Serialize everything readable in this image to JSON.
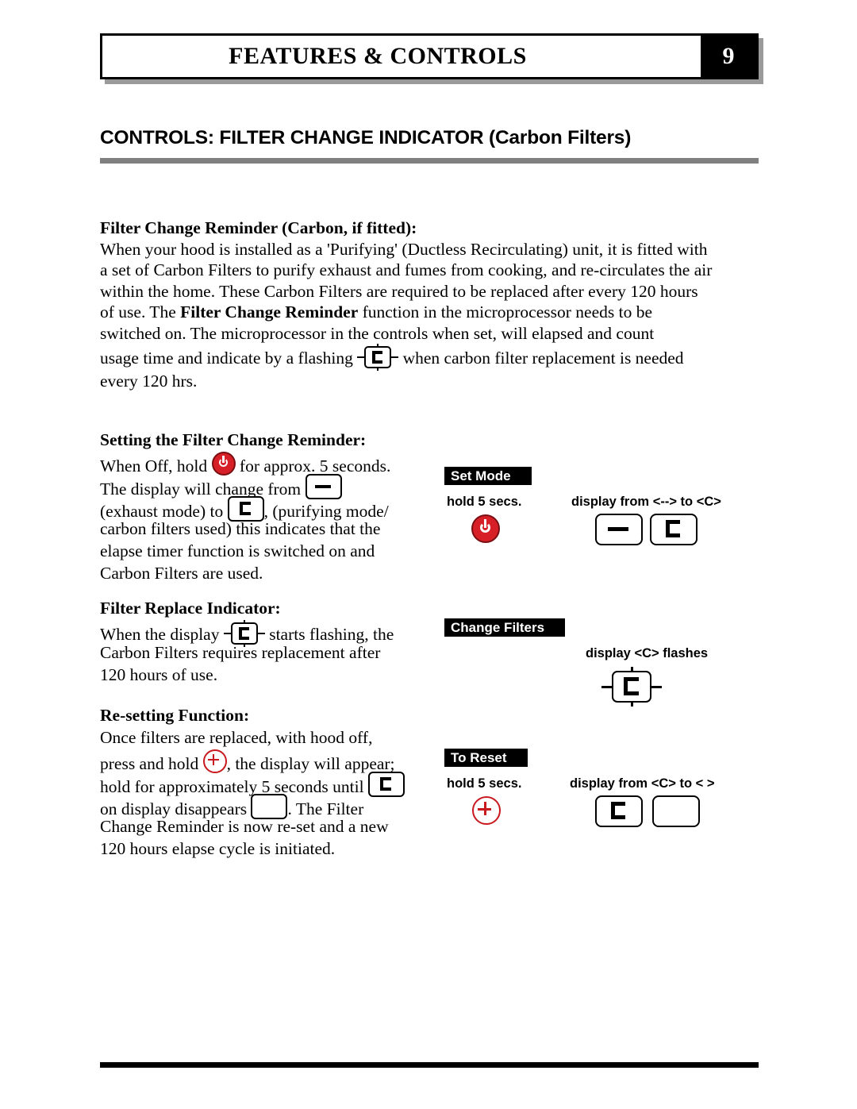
{
  "header": {
    "title": "FEATURES & CONTROLS",
    "page_number": "9"
  },
  "section": {
    "title": "CONTROLS: FILTER CHANGE INDICATOR (Carbon Filters)"
  },
  "intro": {
    "heading": "Filter Change Reminder (Carbon, if fitted):",
    "line1": "When your hood is installed as a 'Purifying' (Ductless Recirculating) unit, it is fitted with",
    "line2": "a set of Carbon Filters to purify exhaust and fumes from cooking, and re-circulates the air",
    "line3": "within the home.  These Carbon Filters are required to be replaced after every 120 hours",
    "line4a": "of use.  The ",
    "line4b": "Filter Change Reminder",
    "line4c": " function in the microprocessor needs to be",
    "line5": "switched on.  The microprocessor in the controls when set, will elapsed and count",
    "line6a": "usage time and indicate by a flashing",
    "line6b": "when carbon filter replacement is needed",
    "line7": "every 120 hrs."
  },
  "setting": {
    "heading": "Setting the Filter Change Reminder:",
    "l1a": "When Off, hold",
    "l1b": "for approx. 5 seconds.",
    "l2a": "The display will change from",
    "l3a": "(exhaust mode) to",
    "l3b": ", (purifying mode/",
    "l4": "carbon filters used) this indicates that the",
    "l5": "elapse timer function is switched on and",
    "l6": "Carbon Filters are used."
  },
  "replace": {
    "heading": "Filter Replace Indicator:",
    "l1a": "When the display",
    "l1b": "starts flashing, the",
    "l2": "Carbon Filters requires replacement after",
    "l3": "120 hours of use."
  },
  "reset": {
    "heading": "Re-setting Function:",
    "l1": "Once filters are replaced, with hood off,",
    "l2a": "press and hold",
    "l2b": ", the display will appear;",
    "l3a": "hold for approximately 5 seconds until",
    "l4a": "on display disappears",
    "l4b": ".  The Filter",
    "l5": "Change Reminder is now re-set and a new",
    "l6": "120 hours elapse cycle is initiated."
  },
  "panels": {
    "set_mode": {
      "tag": "Set Mode",
      "hold_label": "hold 5 secs.",
      "display_label": "display from <--> to <C>"
    },
    "change_filters": {
      "tag": "Change Filters",
      "display_label": "display <C> flashes"
    },
    "to_reset": {
      "tag": "To Reset",
      "hold_label": "hold 5 secs.",
      "display_label": "display from <C> to <  >"
    }
  },
  "colors": {
    "accent_red": "#d61f26",
    "rule_gray": "#808080",
    "black": "#000000"
  }
}
